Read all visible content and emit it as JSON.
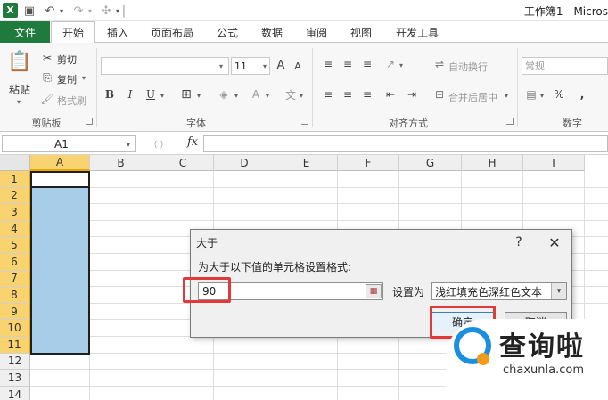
{
  "window": {
    "title": "工作簿1 - Micros"
  },
  "qat": {
    "undo_icon": "undo-icon",
    "redo_icon": "redo-icon",
    "separator": "|"
  },
  "tabs": {
    "file": "文件",
    "items": [
      "开始",
      "插入",
      "页面布局",
      "公式",
      "数据",
      "审阅",
      "视图",
      "开发工具"
    ],
    "active_index": 0
  },
  "ribbon": {
    "clipboard": {
      "label": "剪贴板",
      "paste": "粘贴",
      "cut": "剪切",
      "copy": "复制",
      "format_painter": "格式刷"
    },
    "font": {
      "label": "字体",
      "size": "11",
      "bold": "B",
      "italic": "I",
      "underline": "U",
      "grow": "A",
      "shrink": "A",
      "font_color": "A"
    },
    "alignment": {
      "label": "对齐方式",
      "wrap": "自动换行",
      "merge": "合并后居中"
    },
    "number": {
      "label": "数字",
      "format": "常规",
      "percent": "%",
      "comma": ","
    }
  },
  "formula_bar": {
    "name_box": "A1",
    "fx": "fx",
    "value": ""
  },
  "grid": {
    "columns": [
      "A",
      "B",
      "C",
      "D",
      "E",
      "F",
      "G",
      "H",
      "I"
    ],
    "rows": [
      "1",
      "2",
      "3",
      "4",
      "5",
      "6",
      "7",
      "8",
      "9",
      "10",
      "11",
      "12",
      "13",
      "14"
    ],
    "selected_column": "A",
    "selected_rows_count": 11
  },
  "dialog": {
    "title": "大于",
    "help": "?",
    "close": "✕",
    "prompt": "为大于以下值的单元格设置格式:",
    "value": "90",
    "set_label": "设置为",
    "format_option": "浅红填充色深红色文本",
    "ok": "确定",
    "cancel": "取消"
  },
  "highlight_color": "#e03a3a",
  "watermark": {
    "brand": "查询啦",
    "url": "chaxunla.com"
  }
}
